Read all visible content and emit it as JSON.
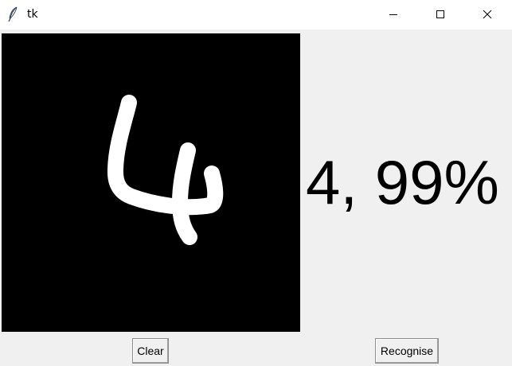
{
  "window": {
    "title": "tk",
    "app_icon": "tk-feather-icon",
    "controls": [
      "minimize-icon",
      "maximize-icon",
      "close-icon"
    ]
  },
  "canvas": {
    "background": "#000000",
    "stroke_color": "#ffffff"
  },
  "result": {
    "text": "4, 99%"
  },
  "buttons": {
    "clear_label": "Clear",
    "recognise_label": "Recognise"
  }
}
